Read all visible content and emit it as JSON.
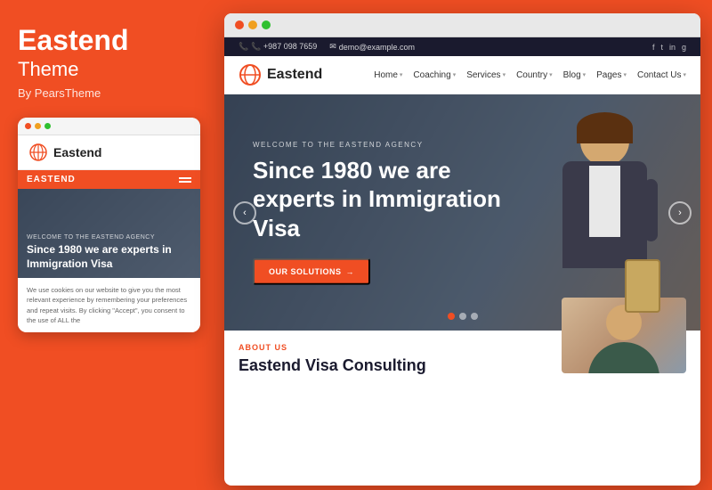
{
  "left": {
    "title": "Eastend",
    "subtitle": "Theme",
    "author": "By PearsTheme"
  },
  "mobile": {
    "logo_text": "Eastend",
    "nav_label": "EASTEND",
    "welcome_text": "WELCOME TO THE EASTEND AGENCY",
    "hero_title": "Since 1980 we are experts in Immigration Visa",
    "body_text": "We use cookies on our website to give you the most relevant experience by remembering your preferences and repeat visits. By clicking \"Accept\", you consent to the use of ALL the"
  },
  "browser": {
    "topbar": {
      "phone": "📞 +987 098 7659",
      "email": "✉ demo@example.com",
      "social": [
        "f",
        "t",
        "in",
        "g"
      ]
    },
    "navbar": {
      "logo": "Eastend",
      "links": [
        "Home",
        "Coaching",
        "Services",
        "Country",
        "Blog",
        "Pages",
        "Contact Us"
      ]
    },
    "hero": {
      "welcome": "WELCOME TO THE EASTEND AGENCY",
      "title": "Since 1980 we are experts in Immigration Visa",
      "cta": "OUR SOLUTIONS"
    },
    "below": {
      "label": "ABOUT US",
      "title": "Eastend Visa Consulting"
    }
  },
  "colors": {
    "brand_orange": "#f04e23",
    "dark_navy": "#1a1a2e",
    "white": "#ffffff"
  }
}
